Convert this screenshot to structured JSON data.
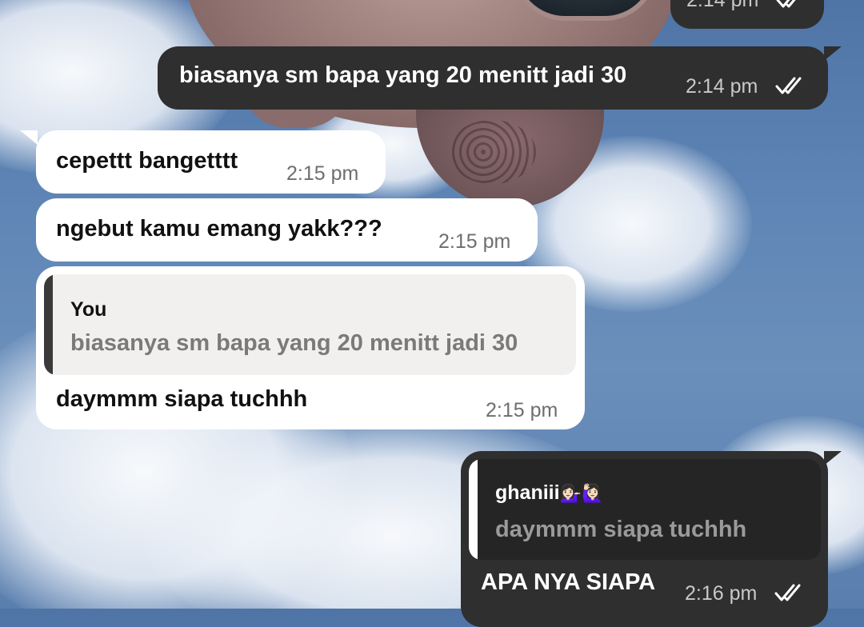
{
  "messages": [
    {
      "direction": "out",
      "time": "2:14 pm",
      "status": "read"
    },
    {
      "direction": "out",
      "text": "biasanya sm bapa yang 20 menitt jadi 30",
      "time": "2:14 pm",
      "status": "read"
    },
    {
      "direction": "in",
      "text": "cepettt bangetttt",
      "time": "2:15 pm"
    },
    {
      "direction": "in",
      "text": "ngebut kamu  emang yakk???",
      "time": "2:15 pm"
    },
    {
      "direction": "in",
      "quote": {
        "author": "You",
        "text": "biasanya sm bapa yang 20 menitt jadi 30"
      },
      "text": "daymmm siapa tuchhh",
      "time": "2:15 pm"
    },
    {
      "direction": "out",
      "quote": {
        "author": "ghaniii",
        "author_emojis": "💁🏻‍♀️🙋🏻‍♀️",
        "text": "daymmm siapa tuchhh"
      },
      "text": "APA NYA SIAPA",
      "time": "2:16 pm",
      "status": "read"
    }
  ],
  "colors": {
    "outgoing_bubble": "#2f2f2f",
    "incoming_bubble": "#ffffff",
    "incoming_quote_bg": "#f2f0ef",
    "incoming_quote_bar": "#3a3a3a",
    "outgoing_quote_bg": "#252525",
    "outgoing_quote_bar": "#ffffff"
  },
  "icons": {
    "read_receipt": "double-check-icon"
  }
}
